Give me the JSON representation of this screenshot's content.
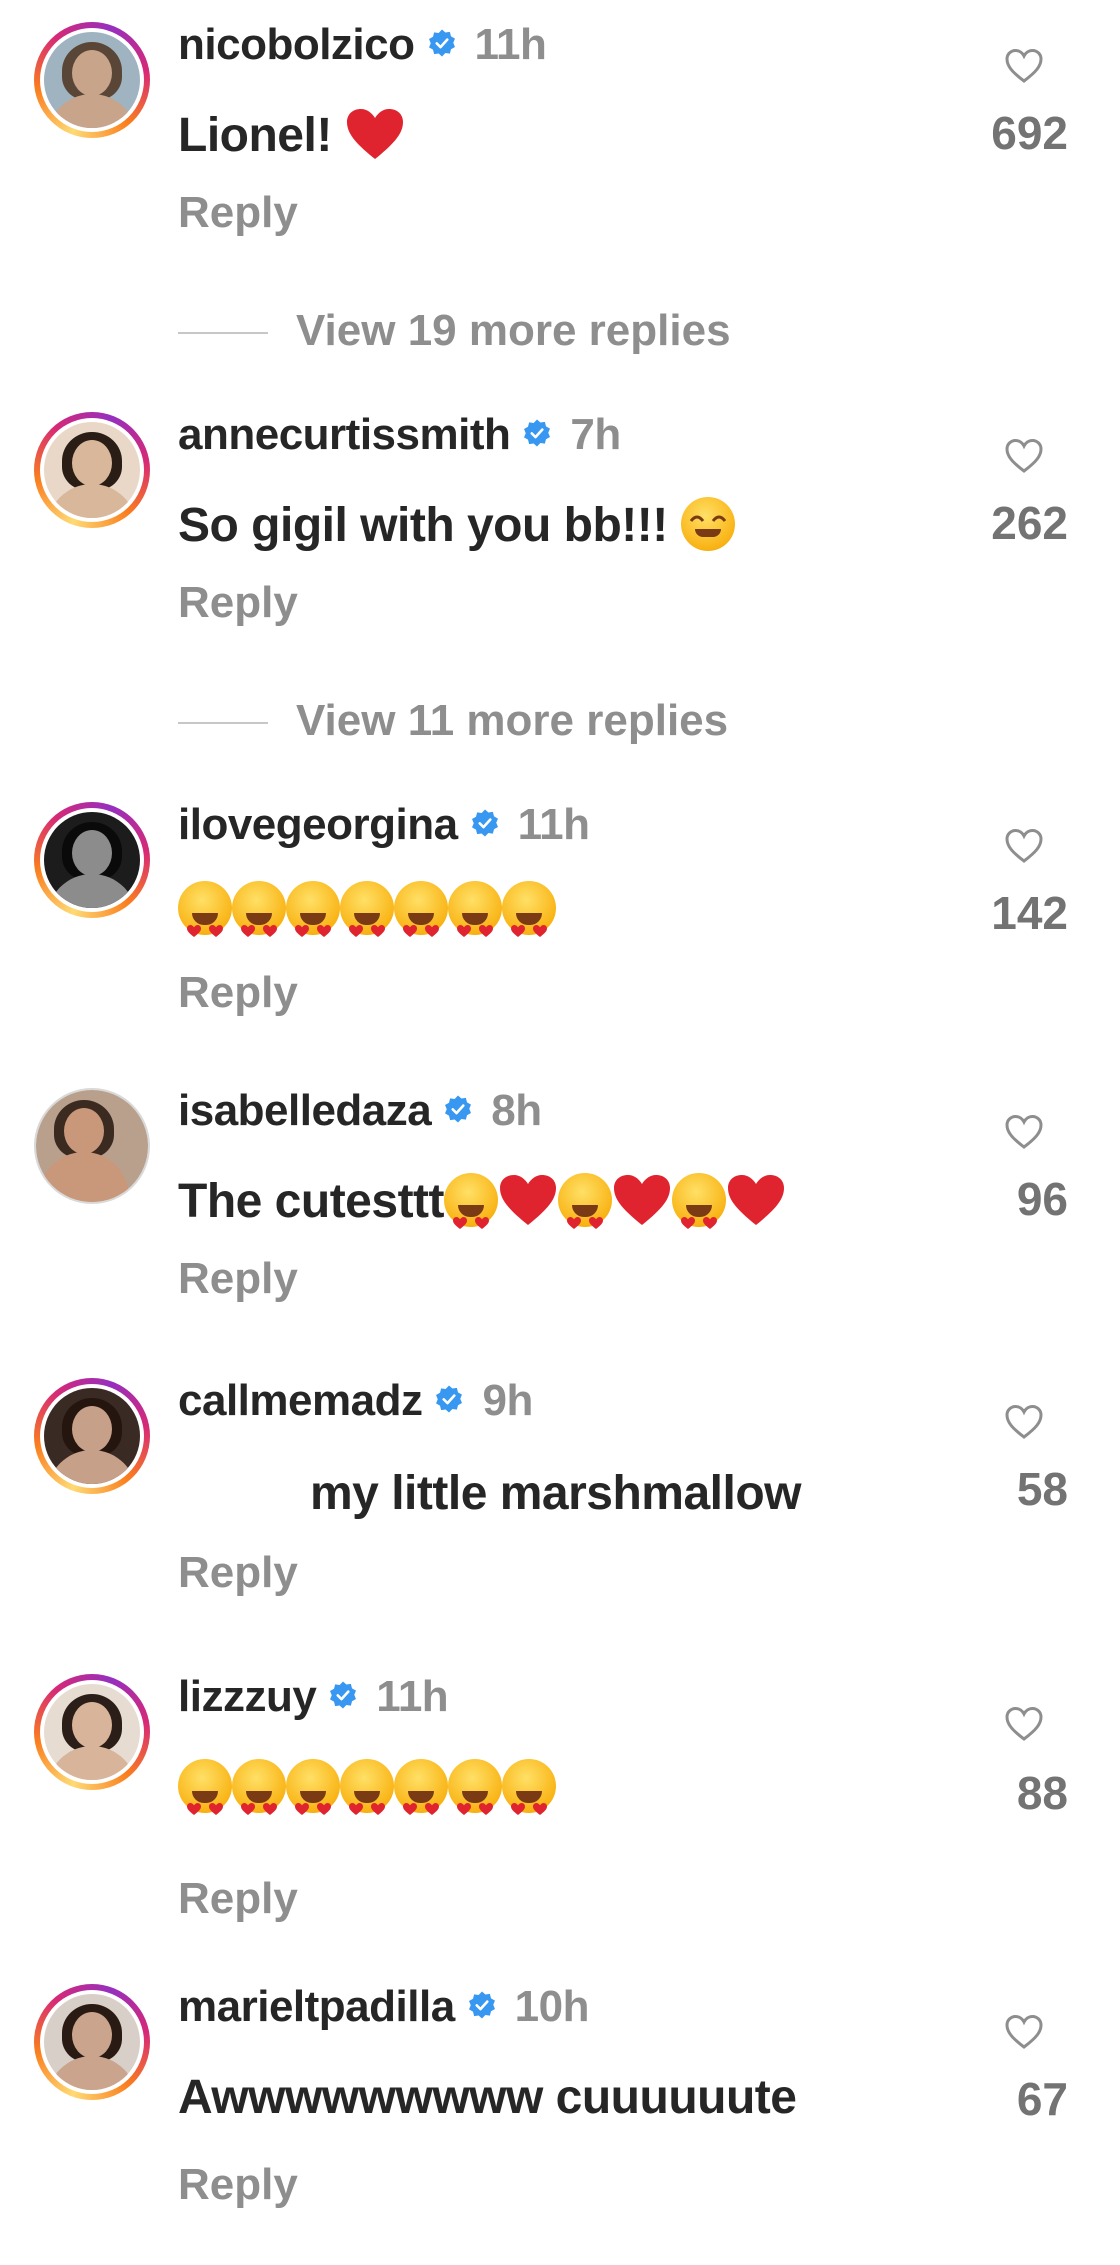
{
  "comments": [
    {
      "username": "nicobolzico",
      "time": "11h",
      "text": "Lionel!",
      "emojis": [
        "red-heart"
      ],
      "reply": "Reply",
      "likes": "692",
      "ring": "gradient",
      "avatar": {
        "bg": "#9fb3c0",
        "skin": "#c8a48a",
        "hair": "#5a4636"
      }
    },
    {
      "username": "annecurtissmith",
      "time": "7h",
      "text": "So gigil with you bb!!!",
      "emojis": [
        "smiling-face-with-hearts"
      ],
      "reply": "Reply",
      "likes": "262",
      "ring": "gradient",
      "avatar": {
        "bg": "#e9d8c8",
        "skin": "#d9b79a",
        "hair": "#2a1d16"
      }
    },
    {
      "username": "ilovegeorgina",
      "time": "11h",
      "text": "",
      "emojis": [
        "heart-eyes",
        "heart-eyes",
        "heart-eyes",
        "heart-eyes",
        "heart-eyes",
        "heart-eyes",
        "heart-eyes"
      ],
      "reply": "Reply",
      "likes": "142",
      "ring": "gradient",
      "avatar": {
        "bg": "#1c1c1c",
        "skin": "#8c8c8c",
        "hair": "#0a0a0a"
      }
    },
    {
      "username": "isabelledaza",
      "time": "8h",
      "text": "The cutesttt",
      "emojis": [
        "heart-eyes",
        "red-heart",
        "heart-eyes",
        "red-heart",
        "heart-eyes",
        "red-heart"
      ],
      "reply": "Reply",
      "likes": "96",
      "ring": "plain",
      "avatar": {
        "bg": "#b9a08c",
        "skin": "#c9987a",
        "hair": "#3b2a20"
      }
    },
    {
      "username": "callmemadz",
      "time": "9h",
      "text": "my little marshmallow",
      "emojis": [],
      "reply": "Reply",
      "likes": "58",
      "ring": "gradient",
      "avatar": {
        "bg": "#3a2a24",
        "skin": "#c7a08a",
        "hair": "#24160f"
      }
    },
    {
      "username": "lizzzuy",
      "time": "11h",
      "text": "",
      "emojis": [
        "heart-eyes",
        "heart-eyes",
        "heart-eyes",
        "heart-eyes",
        "heart-eyes",
        "heart-eyes",
        "heart-eyes"
      ],
      "reply": "Reply",
      "likes": "88",
      "ring": "gradient",
      "avatar": {
        "bg": "#e6dcd2",
        "skin": "#d8b49a",
        "hair": "#2b1e18"
      }
    },
    {
      "username": "marieltpadilla",
      "time": "10h",
      "text": "Awwwwwwwww cuuuuuute",
      "emojis": [],
      "reply": "Reply",
      "likes": "67",
      "ring": "gradient",
      "avatar": {
        "bg": "#d8cfc8",
        "skin": "#caa48c",
        "hair": "#2a1a14"
      }
    }
  ],
  "view_more": [
    {
      "label": "View 19 more replies"
    },
    {
      "label": "View 11 more replies"
    }
  ],
  "colors": {
    "verified": "#3897f0",
    "muted": "#8e8e8e",
    "text": "#262626",
    "heart": "#e0242f"
  }
}
